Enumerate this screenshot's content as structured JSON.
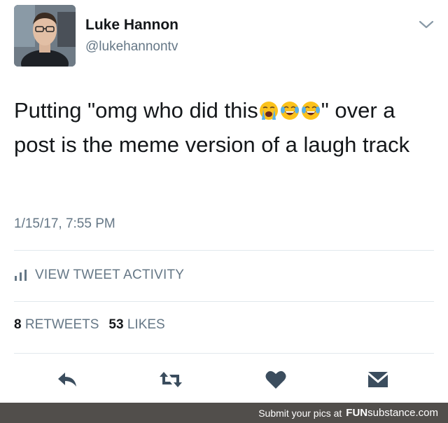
{
  "user": {
    "name": "Luke Hannon",
    "handle": "@lukehannontv"
  },
  "tweet": {
    "text_before": "Putting \"omg who did this",
    "text_after": "\" over a post is the meme version of a laugh track",
    "emojis": [
      "loudly-crying-face",
      "face-with-tears-of-joy",
      "face-with-tears-of-joy"
    ],
    "timestamp": "1/15/17, 7:55 PM"
  },
  "activity": {
    "label": "VIEW TWEET ACTIVITY"
  },
  "stats": {
    "retweets_count": "8",
    "retweets_label": "RETWEETS",
    "likes_count": "53",
    "likes_label": "LIKES"
  },
  "actions": [
    "reply-icon",
    "retweet-icon",
    "like-icon",
    "message-icon"
  ],
  "footer": {
    "text": "Submit your pics at",
    "brand_bold": "FUN",
    "brand_rest": "substance.com"
  },
  "colors": {
    "text": "#14171a",
    "secondary": "#657786",
    "icon": "#3b4d5e",
    "divider": "#e1e8ed",
    "footer_bg": "#514e4b",
    "emoji_yellow": "#fcc21b"
  }
}
